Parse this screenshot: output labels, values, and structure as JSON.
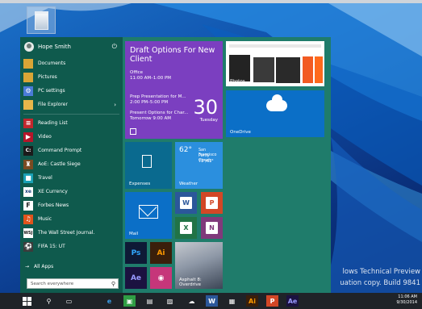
{
  "desktop": {
    "recycle_bin": "Recycle Bin",
    "watermark_line1": "lows Technical Preview",
    "watermark_line2": "uation copy. Build 9841"
  },
  "start_menu": {
    "user": {
      "name": "Hope Smith"
    },
    "pinned": [
      {
        "label": "Documents",
        "icon": "folder-icon"
      },
      {
        "label": "Pictures",
        "icon": "folder-icon"
      },
      {
        "label": "PC settings",
        "icon": "gear-icon"
      },
      {
        "label": "File Explorer",
        "icon": "folder-icon"
      }
    ],
    "apps": [
      {
        "label": "Reading List",
        "icon": "reading-list-icon"
      },
      {
        "label": "Video",
        "icon": "video-icon"
      },
      {
        "label": "Command Prompt",
        "icon": "terminal-icon"
      },
      {
        "label": "AoE: Castle Siege",
        "icon": "game-icon"
      },
      {
        "label": "Travel",
        "icon": "suitcase-icon"
      },
      {
        "label": "XE Currency",
        "icon": "xe-icon"
      },
      {
        "label": "Forbes News",
        "icon": "forbes-icon"
      },
      {
        "label": "Music",
        "icon": "headphones-icon"
      },
      {
        "label": "The Wall Street Journal.",
        "icon": "wsj-icon"
      },
      {
        "label": "FIFA 15: UT",
        "icon": "fifa-icon"
      }
    ],
    "all_apps": "All Apps",
    "search_placeholder": "Search everywhere"
  },
  "tiles": {
    "calendar": {
      "title": "Draft Options For New Client",
      "location": "Office",
      "time": "11:00 AM–1:00 PM",
      "event2_title": "Prep Presentation for M...",
      "event2_time": "2:00 PM–5:00 PM",
      "event3_title": "Present Options for Char...",
      "event3_time": "Tomorrow 9:00 AM",
      "day": "30",
      "weekday": "Tuesday"
    },
    "photos": "Photos",
    "onedrive": "OneDrive",
    "expenses": "Expenses",
    "weather": {
      "label": "Weather",
      "temp": "62°",
      "city": "San Francisco",
      "condition": "Partly Cloudy",
      "range": "71°/61°"
    },
    "mail": "Mail",
    "asphalt": "Asphalt 8: Overdrive"
  },
  "taskbar": {
    "time": "11:06 AM",
    "date": "9/30/2014"
  }
}
